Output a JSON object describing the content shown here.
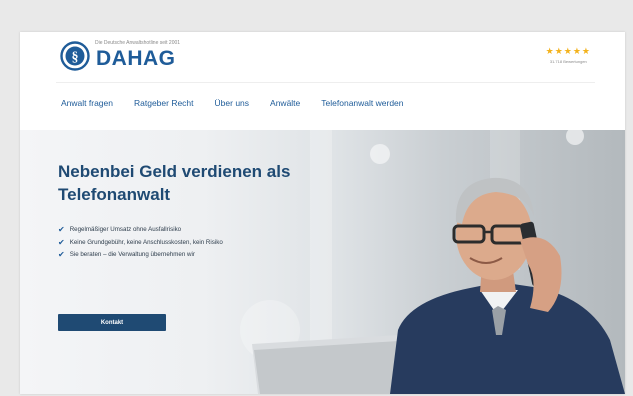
{
  "brand": {
    "name": "DAHAG",
    "tagline": "Die Deutsche Anwaltshotline seit 2001"
  },
  "rating": {
    "stars": "★★★★★",
    "count": "31.718 Bewertungen",
    "value": 4.5
  },
  "nav": {
    "items": [
      {
        "label": "Anwalt fragen"
      },
      {
        "label": "Ratgeber Recht"
      },
      {
        "label": "Über uns"
      },
      {
        "label": "Anwälte"
      },
      {
        "label": "Telefonanwalt werden"
      }
    ]
  },
  "hero": {
    "title_line1": "Nebenbei Geld verdienen als",
    "title_line2": "Telefonanwalt",
    "bullets": [
      {
        "text": "Regelmäßiger Umsatz ohne Ausfallrisiko"
      },
      {
        "text": "Keine Grundgebühr, keine Anschlusskosten, kein Risiko"
      },
      {
        "text": "Sie beraten – die Verwaltung übernehmen wir"
      }
    ],
    "check_icon": "✔",
    "cta_label": "Kontakt"
  },
  "colors": {
    "brand_blue": "#1f5c99",
    "dark_blue": "#1f4a73",
    "star_yellow": "#f3b21c"
  },
  "icons": {
    "logo": "paragraph-shield-icon",
    "check": "check-icon",
    "star": "star-icon"
  }
}
